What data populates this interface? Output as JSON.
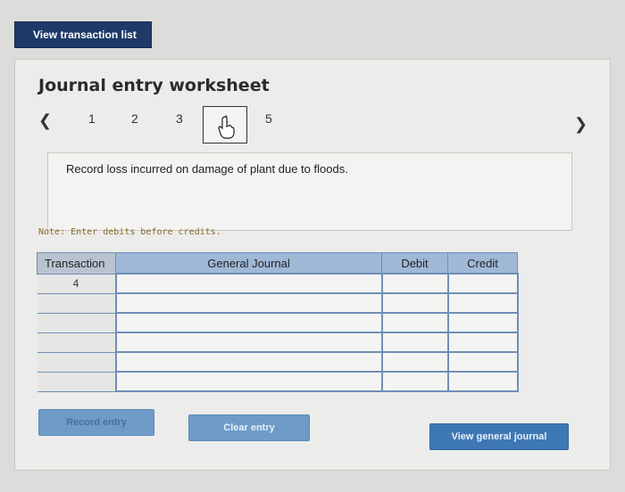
{
  "toolbar": {
    "view_transaction_list": "View transaction list"
  },
  "worksheet": {
    "title": "Journal entry worksheet",
    "pager": {
      "prev_icon": "chevron-left-icon",
      "next_icon": "chevron-right-icon",
      "pages": [
        "1",
        "2",
        "3",
        "4",
        "5"
      ],
      "active_page": "4"
    },
    "prompt": "Record loss incurred on damage of plant due to floods.",
    "note": "Note: Enter debits before credits."
  },
  "journal_table": {
    "headers": {
      "transaction": "Transaction",
      "general_journal": "General Journal",
      "debit": "Debit",
      "credit": "Credit"
    },
    "rows": [
      {
        "transaction": "4",
        "account": "",
        "debit": "",
        "credit": ""
      },
      {
        "transaction": "",
        "account": "",
        "debit": "",
        "credit": ""
      },
      {
        "transaction": "",
        "account": "",
        "debit": "",
        "credit": ""
      },
      {
        "transaction": "",
        "account": "",
        "debit": "",
        "credit": ""
      },
      {
        "transaction": "",
        "account": "",
        "debit": "",
        "credit": ""
      },
      {
        "transaction": "",
        "account": "",
        "debit": "",
        "credit": ""
      }
    ]
  },
  "actions": {
    "record_entry": "Record entry",
    "clear_entry": "Clear entry",
    "view_general_journal": "View general journal"
  }
}
